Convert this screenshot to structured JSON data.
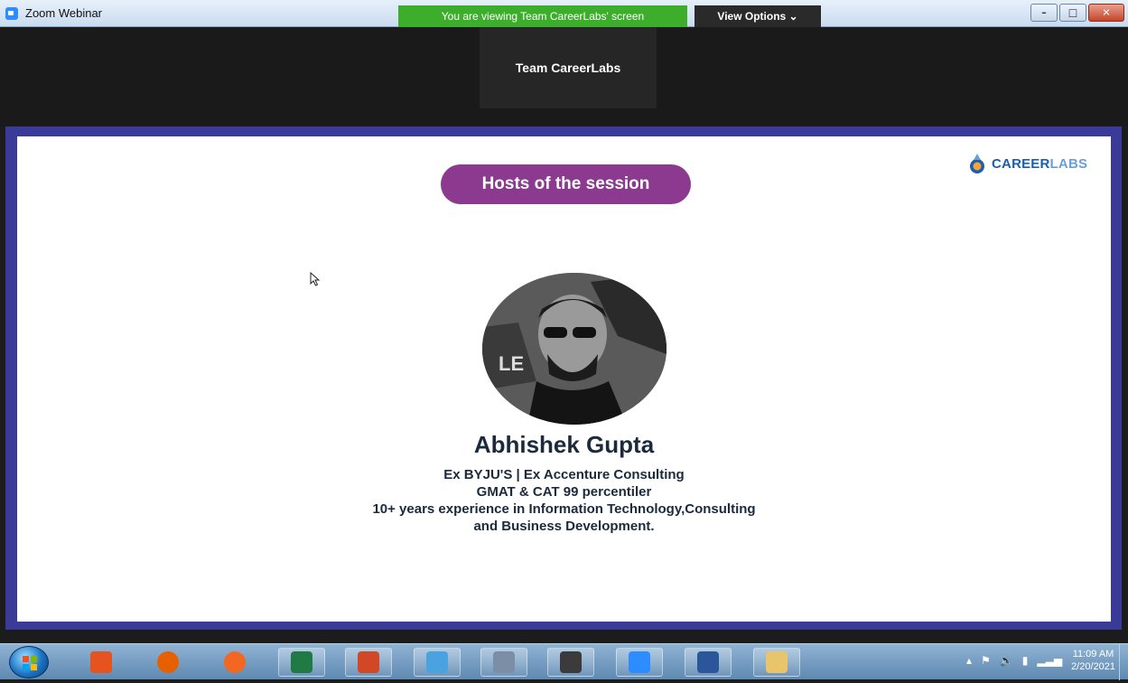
{
  "window": {
    "title": "Zoom Webinar",
    "share_banner": "You are viewing Team CareerLabs' screen",
    "view_options": "View Options ⌄",
    "controls": {
      "minimize": "–",
      "maximize": "□",
      "close": "✕"
    }
  },
  "speaker": {
    "name": "Team CareerLabs"
  },
  "slide": {
    "header_pill": "Hosts of the session",
    "brand": {
      "bold": "CAREER",
      "light": "LABS"
    },
    "host": {
      "name": "Abhishek Gupta",
      "lines": [
        "Ex BYJU'S | Ex Accenture Consulting",
        "GMAT & CAT 99 percentiler",
        "10+ years experience in Information Technology,Consulting",
        "and Business  Development."
      ]
    }
  },
  "taskbar": {
    "apps": [
      {
        "name": "media-player",
        "color": "#e5531e"
      },
      {
        "name": "firefox",
        "color": "#e66000"
      },
      {
        "name": "avast",
        "color": "#f26722"
      },
      {
        "name": "excel",
        "color": "#1f7a44"
      },
      {
        "name": "powerpoint",
        "color": "#d24726"
      },
      {
        "name": "notes",
        "color": "#4aa3df"
      },
      {
        "name": "calculator",
        "color": "#7c8da6"
      },
      {
        "name": "scanner",
        "color": "#3b3b3b"
      },
      {
        "name": "zoom",
        "color": "#2d8cff"
      },
      {
        "name": "word",
        "color": "#2b579a"
      },
      {
        "name": "file-explorer",
        "color": "#e8c46a"
      }
    ],
    "clock": {
      "time": "11:09 AM",
      "date": "2/20/2021"
    }
  }
}
